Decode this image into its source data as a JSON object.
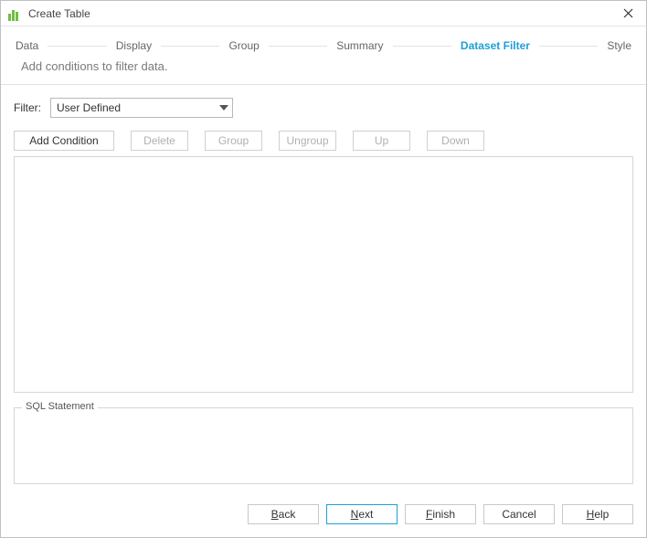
{
  "window": {
    "title": "Create Table"
  },
  "steps": {
    "data": "Data",
    "display": "Display",
    "group": "Group",
    "summary": "Summary",
    "dataset_filter": "Dataset Filter",
    "style": "Style"
  },
  "subtitle": "Add conditions to filter data.",
  "filter": {
    "label": "Filter:",
    "selected": "User Defined"
  },
  "toolbar": {
    "add_condition": "Add Condition",
    "delete": "Delete",
    "group": "Group",
    "ungroup": "Ungroup",
    "up": "Up",
    "down": "Down"
  },
  "sql": {
    "legend": "SQL Statement"
  },
  "footer": {
    "back": "Back",
    "next": "Next",
    "finish": "Finish",
    "cancel": "Cancel",
    "help": "Help"
  }
}
